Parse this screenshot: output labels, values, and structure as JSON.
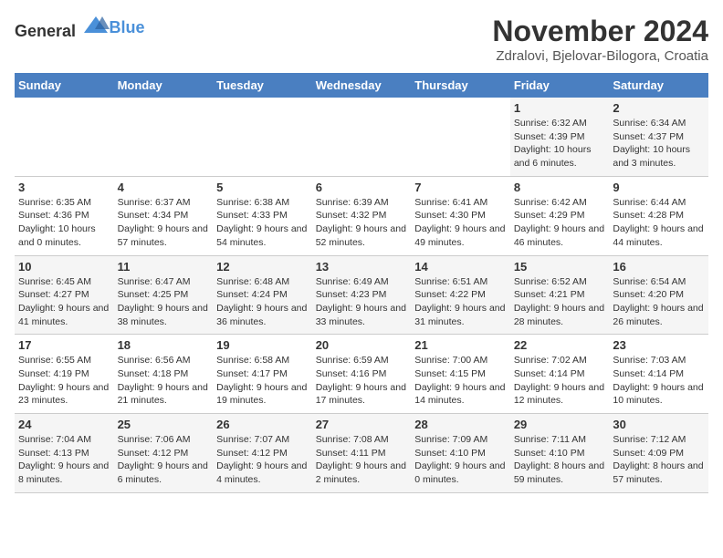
{
  "header": {
    "logo_general": "General",
    "logo_blue": "Blue",
    "month_title": "November 2024",
    "location": "Zdralovi, Bjelovar-Bilogora, Croatia"
  },
  "weekdays": [
    "Sunday",
    "Monday",
    "Tuesday",
    "Wednesday",
    "Thursday",
    "Friday",
    "Saturday"
  ],
  "weeks": [
    [
      {
        "day": "",
        "info": ""
      },
      {
        "day": "",
        "info": ""
      },
      {
        "day": "",
        "info": ""
      },
      {
        "day": "",
        "info": ""
      },
      {
        "day": "",
        "info": ""
      },
      {
        "day": "1",
        "info": "Sunrise: 6:32 AM\nSunset: 4:39 PM\nDaylight: 10 hours and 6 minutes."
      },
      {
        "day": "2",
        "info": "Sunrise: 6:34 AM\nSunset: 4:37 PM\nDaylight: 10 hours and 3 minutes."
      }
    ],
    [
      {
        "day": "3",
        "info": "Sunrise: 6:35 AM\nSunset: 4:36 PM\nDaylight: 10 hours and 0 minutes."
      },
      {
        "day": "4",
        "info": "Sunrise: 6:37 AM\nSunset: 4:34 PM\nDaylight: 9 hours and 57 minutes."
      },
      {
        "day": "5",
        "info": "Sunrise: 6:38 AM\nSunset: 4:33 PM\nDaylight: 9 hours and 54 minutes."
      },
      {
        "day": "6",
        "info": "Sunrise: 6:39 AM\nSunset: 4:32 PM\nDaylight: 9 hours and 52 minutes."
      },
      {
        "day": "7",
        "info": "Sunrise: 6:41 AM\nSunset: 4:30 PM\nDaylight: 9 hours and 49 minutes."
      },
      {
        "day": "8",
        "info": "Sunrise: 6:42 AM\nSunset: 4:29 PM\nDaylight: 9 hours and 46 minutes."
      },
      {
        "day": "9",
        "info": "Sunrise: 6:44 AM\nSunset: 4:28 PM\nDaylight: 9 hours and 44 minutes."
      }
    ],
    [
      {
        "day": "10",
        "info": "Sunrise: 6:45 AM\nSunset: 4:27 PM\nDaylight: 9 hours and 41 minutes."
      },
      {
        "day": "11",
        "info": "Sunrise: 6:47 AM\nSunset: 4:25 PM\nDaylight: 9 hours and 38 minutes."
      },
      {
        "day": "12",
        "info": "Sunrise: 6:48 AM\nSunset: 4:24 PM\nDaylight: 9 hours and 36 minutes."
      },
      {
        "day": "13",
        "info": "Sunrise: 6:49 AM\nSunset: 4:23 PM\nDaylight: 9 hours and 33 minutes."
      },
      {
        "day": "14",
        "info": "Sunrise: 6:51 AM\nSunset: 4:22 PM\nDaylight: 9 hours and 31 minutes."
      },
      {
        "day": "15",
        "info": "Sunrise: 6:52 AM\nSunset: 4:21 PM\nDaylight: 9 hours and 28 minutes."
      },
      {
        "day": "16",
        "info": "Sunrise: 6:54 AM\nSunset: 4:20 PM\nDaylight: 9 hours and 26 minutes."
      }
    ],
    [
      {
        "day": "17",
        "info": "Sunrise: 6:55 AM\nSunset: 4:19 PM\nDaylight: 9 hours and 23 minutes."
      },
      {
        "day": "18",
        "info": "Sunrise: 6:56 AM\nSunset: 4:18 PM\nDaylight: 9 hours and 21 minutes."
      },
      {
        "day": "19",
        "info": "Sunrise: 6:58 AM\nSunset: 4:17 PM\nDaylight: 9 hours and 19 minutes."
      },
      {
        "day": "20",
        "info": "Sunrise: 6:59 AM\nSunset: 4:16 PM\nDaylight: 9 hours and 17 minutes."
      },
      {
        "day": "21",
        "info": "Sunrise: 7:00 AM\nSunset: 4:15 PM\nDaylight: 9 hours and 14 minutes."
      },
      {
        "day": "22",
        "info": "Sunrise: 7:02 AM\nSunset: 4:14 PM\nDaylight: 9 hours and 12 minutes."
      },
      {
        "day": "23",
        "info": "Sunrise: 7:03 AM\nSunset: 4:14 PM\nDaylight: 9 hours and 10 minutes."
      }
    ],
    [
      {
        "day": "24",
        "info": "Sunrise: 7:04 AM\nSunset: 4:13 PM\nDaylight: 9 hours and 8 minutes."
      },
      {
        "day": "25",
        "info": "Sunrise: 7:06 AM\nSunset: 4:12 PM\nDaylight: 9 hours and 6 minutes."
      },
      {
        "day": "26",
        "info": "Sunrise: 7:07 AM\nSunset: 4:12 PM\nDaylight: 9 hours and 4 minutes."
      },
      {
        "day": "27",
        "info": "Sunrise: 7:08 AM\nSunset: 4:11 PM\nDaylight: 9 hours and 2 minutes."
      },
      {
        "day": "28",
        "info": "Sunrise: 7:09 AM\nSunset: 4:10 PM\nDaylight: 9 hours and 0 minutes."
      },
      {
        "day": "29",
        "info": "Sunrise: 7:11 AM\nSunset: 4:10 PM\nDaylight: 8 hours and 59 minutes."
      },
      {
        "day": "30",
        "info": "Sunrise: 7:12 AM\nSunset: 4:09 PM\nDaylight: 8 hours and 57 minutes."
      }
    ]
  ]
}
